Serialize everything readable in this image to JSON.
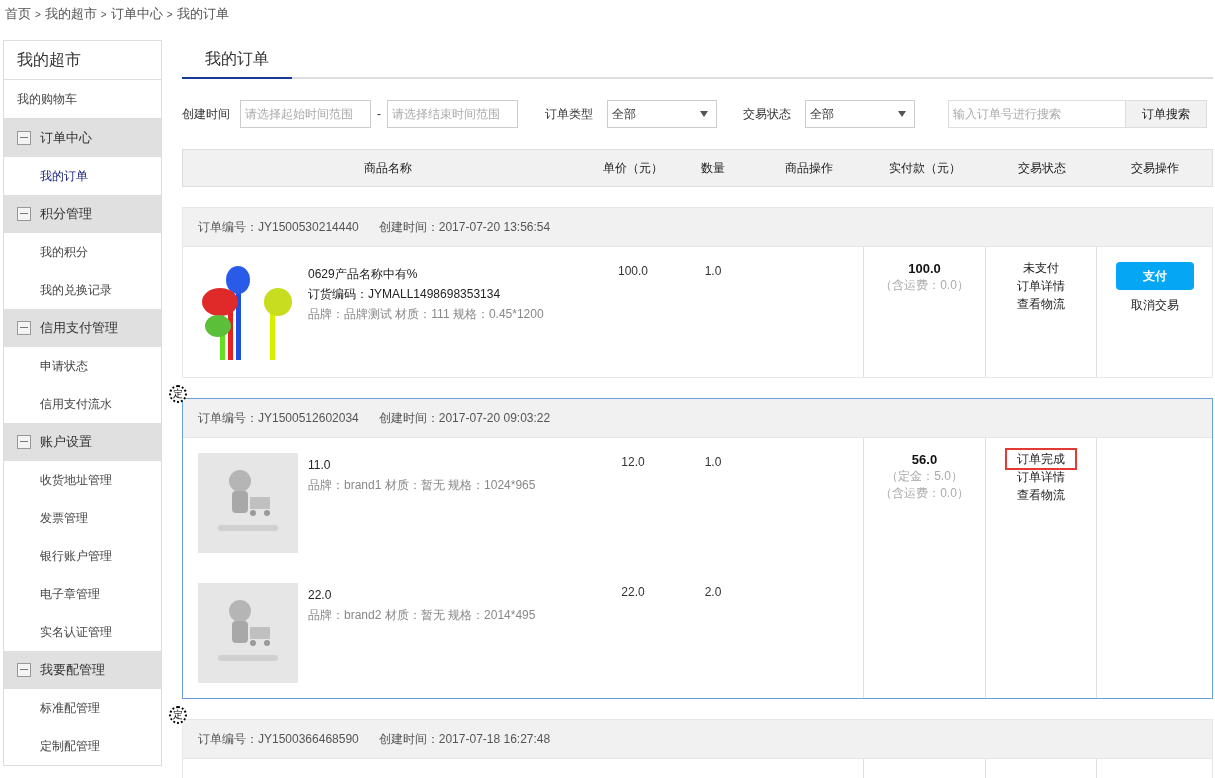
{
  "breadcrumb": [
    "首页",
    "我的超市",
    "订单中心",
    "我的订单"
  ],
  "breadcrumb_separator": ">",
  "sidebar": {
    "title": "我的超市",
    "items": [
      {
        "label": "我的购物车",
        "selected": false
      },
      {
        "label": "订单中心",
        "expanded": true,
        "children": [
          {
            "label": "我的订单",
            "selected": true
          }
        ]
      },
      {
        "label": "积分管理",
        "expanded": true,
        "children": [
          {
            "label": "我的积分",
            "selected": false
          },
          {
            "label": "我的兑换记录",
            "selected": false
          }
        ]
      },
      {
        "label": "信用支付管理",
        "expanded": true,
        "children": [
          {
            "label": "申请状态",
            "selected": false
          },
          {
            "label": "信用支付流水",
            "selected": false
          }
        ]
      },
      {
        "label": "账户设置",
        "expanded": true,
        "children": [
          {
            "label": "收货地址管理",
            "selected": false
          },
          {
            "label": "发票管理",
            "selected": false
          },
          {
            "label": "银行账户管理",
            "selected": false
          },
          {
            "label": "电子章管理",
            "selected": false
          },
          {
            "label": "实名认证管理",
            "selected": false
          }
        ]
      },
      {
        "label": "我要配管理",
        "expanded": true,
        "children": [
          {
            "label": "标准配管理",
            "selected": false
          },
          {
            "label": "定制配管理",
            "selected": false
          }
        ]
      }
    ]
  },
  "tabs": [
    {
      "label": "我的订单",
      "selected": true
    }
  ],
  "filters": {
    "time_label": "创建时间",
    "start_placeholder": "请选择起始时间范围",
    "separator": "-",
    "end_placeholder": "请选择结束时间范围",
    "type_label": "订单类型",
    "type_value": "全部",
    "status_label": "交易状态",
    "status_value": "全部",
    "search_placeholder": "输入订单号进行搜索",
    "search_button": "订单搜索"
  },
  "table": {
    "columns": [
      "商品名称",
      "单价（元）",
      "数量",
      "商品操作",
      "实付款（元）",
      "交易状态",
      "交易操作"
    ]
  },
  "orders": [
    {
      "order_no": "订单编号：JY1500530214440",
      "created": "创建时间：2017-07-20 13:56:54",
      "selected": false,
      "products": [
        {
          "name": "0629产品名称中有%",
          "code": "订货编码：JYMALL1498698353134",
          "attrs": "品牌：品牌测试 材质：111 规格：0.45*1200",
          "price": "100.0",
          "qty": "1.0"
        }
      ],
      "total": "100.0",
      "notes": [
        "（含运费：0.0）"
      ],
      "status": [
        {
          "label": "未支付",
          "highlighted": false
        },
        {
          "label": "订单详情",
          "highlighted": false
        },
        {
          "label": "查看物流",
          "highlighted": false
        }
      ],
      "actions": [
        {
          "kind": "button",
          "label": "支付"
        },
        {
          "kind": "link",
          "label": "取消交易"
        }
      ]
    },
    {
      "badge": "定",
      "order_no": "订单编号：JY1500512602034",
      "created": "创建时间：2017-07-20 09:03:22",
      "selected": true,
      "products": [
        {
          "name": "11.0",
          "attrs": "品牌：brand1 材质：暂无 规格：1024*965",
          "price": "12.0",
          "qty": "1.0"
        },
        {
          "name": "22.0",
          "attrs": "品牌：brand2 材质：暂无 规格：2014*495",
          "price": "22.0",
          "qty": "2.0"
        }
      ],
      "total": "56.0",
      "notes": [
        "（定金：5.0）",
        "（含运费：0.0）"
      ],
      "status": [
        {
          "label": "订单完成",
          "highlighted": true
        },
        {
          "label": "订单详情",
          "highlighted": false
        },
        {
          "label": "查看物流",
          "highlighted": false
        }
      ]
    },
    {
      "badge": "定",
      "order_no": "订单编号：JY1500366468590",
      "created": "创建时间：2017-07-18 16:27:48",
      "selected": false
    }
  ]
}
